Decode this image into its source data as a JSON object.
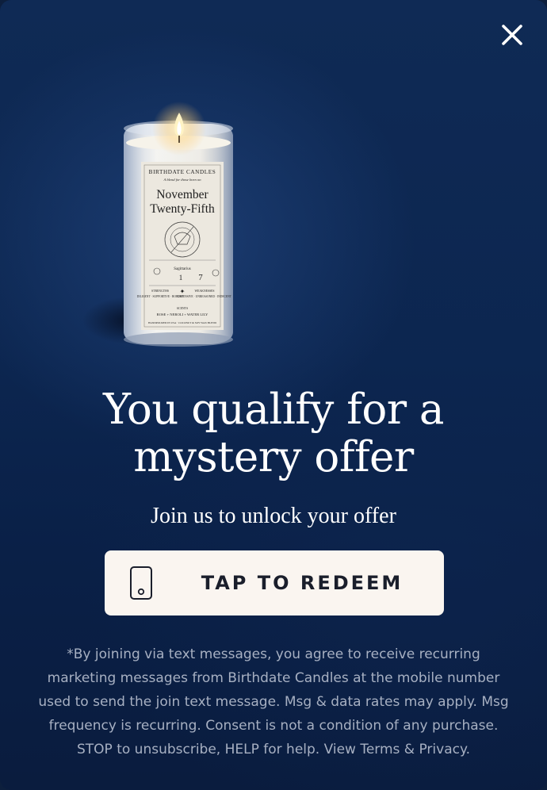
{
  "modal": {
    "close_icon": "close-icon",
    "product_image": {
      "brand": "BIRTHDATE CANDLES",
      "tagline": "A blend for those born on",
      "date_line1": "November",
      "date_line2": "Twenty-Fifth",
      "seal_text": "THE DAY OF INSPIRED PERSEVERANCE",
      "sign": "Sagittarius",
      "number_left": "1",
      "number_right": "7",
      "strengths_title": "STRENGTHS",
      "strengths": "DILIGENT · SUPPORTIVE · ROBUST",
      "weakness_title": "WEAKNESSES",
      "weaknesses": "DEFENSIVE · UNREASONED · INDECENT",
      "scents_title": "SCENTS",
      "scents": "ROSE + NEROLI + WATER LILY",
      "footer": "HANDPOURED IN USA · COCONUT & SOY WAX BLEND"
    },
    "headline_line1": "You qualify for a",
    "headline_line2": "mystery offer",
    "subhead": "Join us to unlock your offer",
    "cta": {
      "icon": "phone-icon",
      "label": "TAP TO REDEEM"
    },
    "disclaimer_lines": [
      "*By joining via text messages, you agree to receive recurring",
      "marketing messages from Birthdate Candles at the mobile number",
      "used to send the join text message. Msg & data rates may apply. Msg",
      "frequency is recurring. Consent is not a condition of any purchase.",
      "STOP to unsubscribe, HELP for help. View Terms & Privacy."
    ]
  },
  "colors": {
    "background": "#0c2650",
    "cta_background": "#faf5f0",
    "cta_text": "#1a1e2b",
    "headline": "#ffffff",
    "disclaimer": "#a7b0c2"
  }
}
